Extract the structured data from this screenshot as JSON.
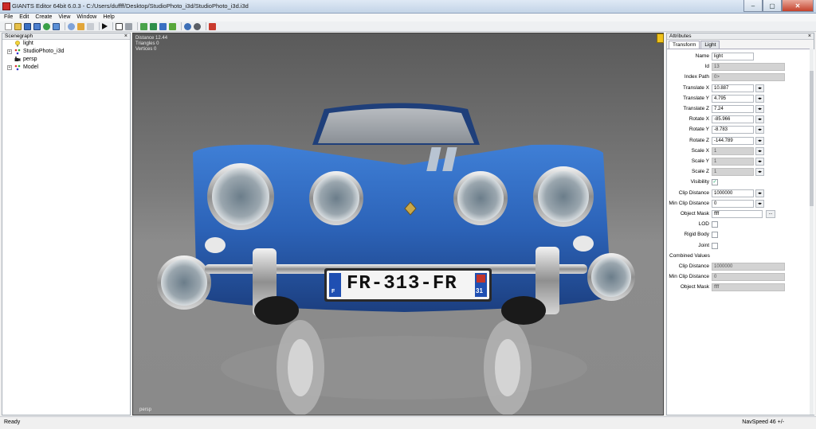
{
  "window": {
    "title": "GIANTS Editor 64bit 6.0.3 - C:/Users/duffff/Desktop/StudioPhoto_i3d/StudioPhoto_i3d.i3d",
    "minimize": "–",
    "maximize": "▢",
    "close": "✕"
  },
  "menu": [
    "File",
    "Edit",
    "Create",
    "View",
    "Window",
    "Help"
  ],
  "toolbar": {
    "icons": [
      "new-icon",
      "open-icon",
      "save-icon",
      "save-as-icon",
      "reload-icon",
      "import-icon",
      "export-icon",
      "undo-icon",
      "redo-icon",
      "play-icon",
      "select-icon",
      "lock-icon",
      "terrain-icon",
      "paint-icon",
      "foliage-icon",
      "decal-icon",
      "settings-icon",
      "gear-icon",
      "recorder-icon"
    ]
  },
  "scenegraph": {
    "title": "Scenegraph",
    "close": "×",
    "items": [
      {
        "label": "light",
        "icon": "light-bulb-icon",
        "expandable": false
      },
      {
        "label": "StudioPhoto_i3d",
        "icon": "transform-group-icon",
        "expandable": true
      },
      {
        "label": "persp",
        "icon": "camera-icon",
        "expandable": false
      },
      {
        "label": "Model",
        "icon": "transform-group-icon",
        "expandable": true
      }
    ]
  },
  "viewport": {
    "stats": [
      "Distance 12.44",
      "Triangles 0",
      "Vertices 0"
    ],
    "camera": "persp",
    "plate": {
      "text": "FR-313-FR",
      "country": "F",
      "region": "31"
    }
  },
  "attributes": {
    "title": "Attributes",
    "close": "×",
    "tabs": [
      "Transform",
      "Light"
    ],
    "active_tab": "Transform",
    "rows": [
      {
        "label": "Name",
        "value": "light",
        "kind": "field"
      },
      {
        "label": "Id",
        "value": "13",
        "kind": "readonly"
      },
      {
        "label": "Index Path",
        "value": "0>",
        "kind": "readonly"
      },
      {
        "label": "Translate X",
        "value": "10.887",
        "kind": "spin"
      },
      {
        "label": "Translate Y",
        "value": "4.795",
        "kind": "spin"
      },
      {
        "label": "Translate Z",
        "value": "7.24",
        "kind": "spin"
      },
      {
        "label": "Rotate X",
        "value": "-85.966",
        "kind": "spin"
      },
      {
        "label": "Rotate Y",
        "value": "-8.783",
        "kind": "spin"
      },
      {
        "label": "Rotate Z",
        "value": "-144.789",
        "kind": "spin"
      },
      {
        "label": "Scale X",
        "value": "1",
        "kind": "spin-ro"
      },
      {
        "label": "Scale Y",
        "value": "1",
        "kind": "spin-ro"
      },
      {
        "label": "Scale Z",
        "value": "1",
        "kind": "spin-ro"
      },
      {
        "label": "Visibility",
        "value": "✓",
        "kind": "check"
      },
      {
        "label": "Clip Distance",
        "value": "1000000",
        "kind": "spin"
      },
      {
        "label": "Min Clip Distance",
        "value": "0",
        "kind": "spin"
      },
      {
        "label": "Object Mask",
        "value": "ffff",
        "kind": "mask"
      },
      {
        "label": "LOD",
        "value": "",
        "kind": "check"
      },
      {
        "label": "Rigid Body",
        "value": "",
        "kind": "check"
      },
      {
        "label": "Joint",
        "value": "",
        "kind": "check"
      },
      {
        "label": "Combined Values",
        "value": "",
        "kind": "section"
      },
      {
        "label": "Clip Distance",
        "value": "1000000",
        "kind": "readonly"
      },
      {
        "label": "Min Clip Distance",
        "value": "0",
        "kind": "readonly"
      },
      {
        "label": "Object Mask",
        "value": "ffff",
        "kind": "readonly"
      }
    ],
    "spin_glyph": "◂▸",
    "mask_button": "..."
  },
  "status": {
    "text": "Ready",
    "navspeed": "NavSpeed 46 +/-"
  }
}
